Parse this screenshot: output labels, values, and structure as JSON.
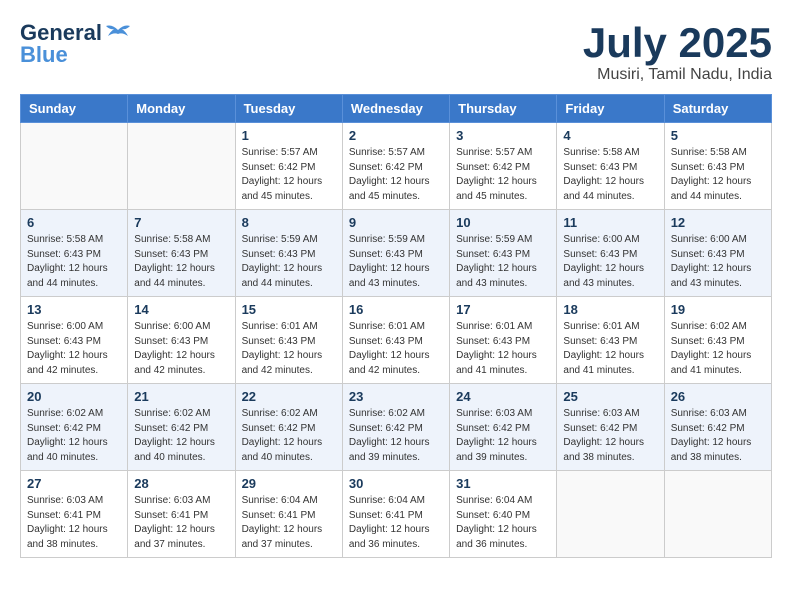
{
  "header": {
    "logo_general": "General",
    "logo_blue": "Blue",
    "title": "July 2025",
    "subtitle": "Musiri, Tamil Nadu, India"
  },
  "days_of_week": [
    "Sunday",
    "Monday",
    "Tuesday",
    "Wednesday",
    "Thursday",
    "Friday",
    "Saturday"
  ],
  "weeks": [
    [
      {
        "day": "",
        "info": ""
      },
      {
        "day": "",
        "info": ""
      },
      {
        "day": "1",
        "info": "Sunrise: 5:57 AM\nSunset: 6:42 PM\nDaylight: 12 hours and 45 minutes."
      },
      {
        "day": "2",
        "info": "Sunrise: 5:57 AM\nSunset: 6:42 PM\nDaylight: 12 hours and 45 minutes."
      },
      {
        "day": "3",
        "info": "Sunrise: 5:57 AM\nSunset: 6:42 PM\nDaylight: 12 hours and 45 minutes."
      },
      {
        "day": "4",
        "info": "Sunrise: 5:58 AM\nSunset: 6:43 PM\nDaylight: 12 hours and 44 minutes."
      },
      {
        "day": "5",
        "info": "Sunrise: 5:58 AM\nSunset: 6:43 PM\nDaylight: 12 hours and 44 minutes."
      }
    ],
    [
      {
        "day": "6",
        "info": "Sunrise: 5:58 AM\nSunset: 6:43 PM\nDaylight: 12 hours and 44 minutes."
      },
      {
        "day": "7",
        "info": "Sunrise: 5:58 AM\nSunset: 6:43 PM\nDaylight: 12 hours and 44 minutes."
      },
      {
        "day": "8",
        "info": "Sunrise: 5:59 AM\nSunset: 6:43 PM\nDaylight: 12 hours and 44 minutes."
      },
      {
        "day": "9",
        "info": "Sunrise: 5:59 AM\nSunset: 6:43 PM\nDaylight: 12 hours and 43 minutes."
      },
      {
        "day": "10",
        "info": "Sunrise: 5:59 AM\nSunset: 6:43 PM\nDaylight: 12 hours and 43 minutes."
      },
      {
        "day": "11",
        "info": "Sunrise: 6:00 AM\nSunset: 6:43 PM\nDaylight: 12 hours and 43 minutes."
      },
      {
        "day": "12",
        "info": "Sunrise: 6:00 AM\nSunset: 6:43 PM\nDaylight: 12 hours and 43 minutes."
      }
    ],
    [
      {
        "day": "13",
        "info": "Sunrise: 6:00 AM\nSunset: 6:43 PM\nDaylight: 12 hours and 42 minutes."
      },
      {
        "day": "14",
        "info": "Sunrise: 6:00 AM\nSunset: 6:43 PM\nDaylight: 12 hours and 42 minutes."
      },
      {
        "day": "15",
        "info": "Sunrise: 6:01 AM\nSunset: 6:43 PM\nDaylight: 12 hours and 42 minutes."
      },
      {
        "day": "16",
        "info": "Sunrise: 6:01 AM\nSunset: 6:43 PM\nDaylight: 12 hours and 42 minutes."
      },
      {
        "day": "17",
        "info": "Sunrise: 6:01 AM\nSunset: 6:43 PM\nDaylight: 12 hours and 41 minutes."
      },
      {
        "day": "18",
        "info": "Sunrise: 6:01 AM\nSunset: 6:43 PM\nDaylight: 12 hours and 41 minutes."
      },
      {
        "day": "19",
        "info": "Sunrise: 6:02 AM\nSunset: 6:43 PM\nDaylight: 12 hours and 41 minutes."
      }
    ],
    [
      {
        "day": "20",
        "info": "Sunrise: 6:02 AM\nSunset: 6:42 PM\nDaylight: 12 hours and 40 minutes."
      },
      {
        "day": "21",
        "info": "Sunrise: 6:02 AM\nSunset: 6:42 PM\nDaylight: 12 hours and 40 minutes."
      },
      {
        "day": "22",
        "info": "Sunrise: 6:02 AM\nSunset: 6:42 PM\nDaylight: 12 hours and 40 minutes."
      },
      {
        "day": "23",
        "info": "Sunrise: 6:02 AM\nSunset: 6:42 PM\nDaylight: 12 hours and 39 minutes."
      },
      {
        "day": "24",
        "info": "Sunrise: 6:03 AM\nSunset: 6:42 PM\nDaylight: 12 hours and 39 minutes."
      },
      {
        "day": "25",
        "info": "Sunrise: 6:03 AM\nSunset: 6:42 PM\nDaylight: 12 hours and 38 minutes."
      },
      {
        "day": "26",
        "info": "Sunrise: 6:03 AM\nSunset: 6:42 PM\nDaylight: 12 hours and 38 minutes."
      }
    ],
    [
      {
        "day": "27",
        "info": "Sunrise: 6:03 AM\nSunset: 6:41 PM\nDaylight: 12 hours and 38 minutes."
      },
      {
        "day": "28",
        "info": "Sunrise: 6:03 AM\nSunset: 6:41 PM\nDaylight: 12 hours and 37 minutes."
      },
      {
        "day": "29",
        "info": "Sunrise: 6:04 AM\nSunset: 6:41 PM\nDaylight: 12 hours and 37 minutes."
      },
      {
        "day": "30",
        "info": "Sunrise: 6:04 AM\nSunset: 6:41 PM\nDaylight: 12 hours and 36 minutes."
      },
      {
        "day": "31",
        "info": "Sunrise: 6:04 AM\nSunset: 6:40 PM\nDaylight: 12 hours and 36 minutes."
      },
      {
        "day": "",
        "info": ""
      },
      {
        "day": "",
        "info": ""
      }
    ]
  ]
}
